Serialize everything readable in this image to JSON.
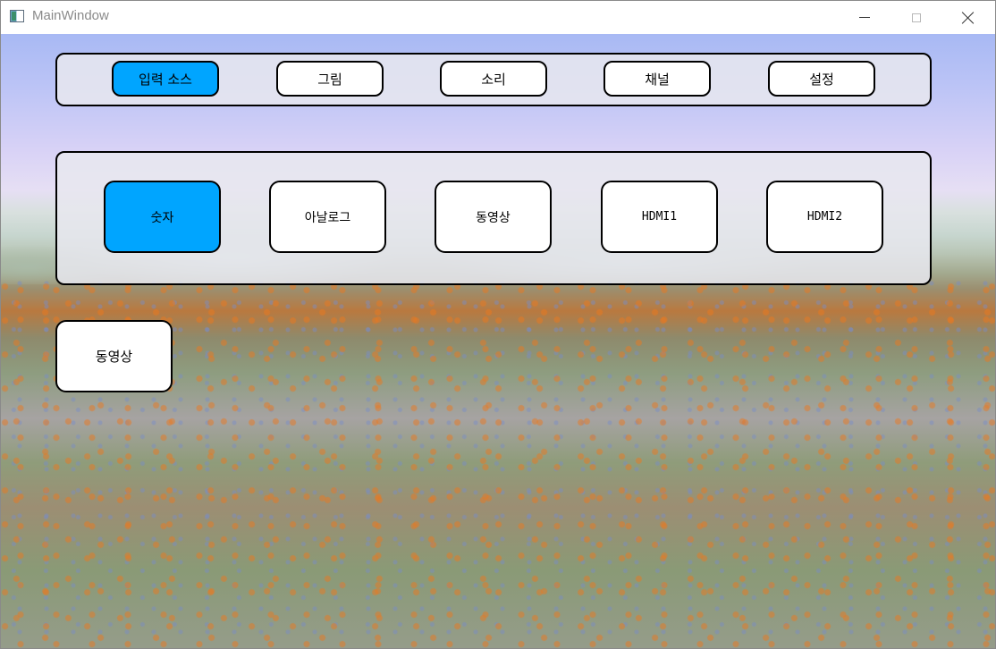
{
  "window": {
    "title": "MainWindow"
  },
  "tabs": [
    {
      "label": "입력 소스",
      "active": true
    },
    {
      "label": "그림",
      "active": false
    },
    {
      "label": "소리",
      "active": false
    },
    {
      "label": "채널",
      "active": false
    },
    {
      "label": "설정",
      "active": false
    }
  ],
  "sources": [
    {
      "label": "숫자",
      "active": true
    },
    {
      "label": "아날로그",
      "active": false
    },
    {
      "label": "동영상",
      "active": false
    },
    {
      "label": "HDMI1",
      "active": false
    },
    {
      "label": "HDMI2",
      "active": false
    }
  ],
  "selected_source": {
    "label": "동영상"
  },
  "colors": {
    "active": "#00a5ff",
    "button": "#ffffff",
    "border": "#000000",
    "panel": "#e8e8ee"
  }
}
